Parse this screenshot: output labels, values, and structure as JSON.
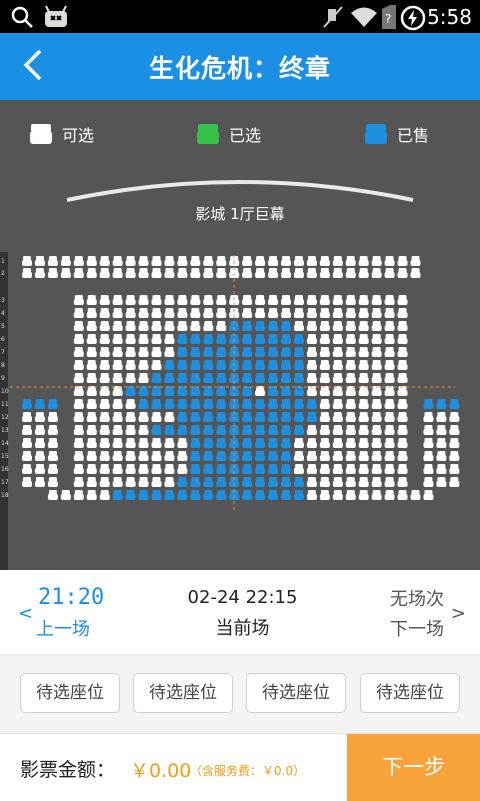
{
  "status_bar": {
    "time": "5:58",
    "icons": [
      "search-icon",
      "android-icon",
      "mute-icon",
      "wifi-icon",
      "no-sim-icon",
      "battery-charging-icon"
    ]
  },
  "header": {
    "back_icon": "chevron-left-icon",
    "title": "生化危机：终章"
  },
  "legend": [
    {
      "label": "可选",
      "color": "#ffffff"
    },
    {
      "label": "已选",
      "color": "#35c34a"
    },
    {
      "label": "已售",
      "color": "#1f8fe0"
    }
  ],
  "seat_map": {
    "screen_label": "影城 1厅巨幕",
    "row_numbers": [
      "1",
      "2",
      "3",
      "4",
      "5",
      "6",
      "7",
      "8",
      "9",
      "10",
      "11",
      "12",
      "13",
      "14",
      "15",
      "16",
      "17",
      "18"
    ],
    "colors": {
      "available": "#ffffff",
      "sold": "#1f8fe0",
      "guide": "#e8942a",
      "background": "#555555"
    }
  },
  "showtimes": {
    "previous": {
      "time": "21:20",
      "label": "上一场"
    },
    "current": {
      "datetime": "02-24 22:15",
      "label": "当前场"
    },
    "next": {
      "status": "无场次",
      "label": "下一场"
    }
  },
  "selected_seats": [
    "待选座位",
    "待选座位",
    "待选座位",
    "待选座位"
  ],
  "footer": {
    "amount_label": "影票金额：",
    "amount": "￥0.00",
    "service_fee": "（含服务费：￥0.0）",
    "next_button": "下一步"
  }
}
